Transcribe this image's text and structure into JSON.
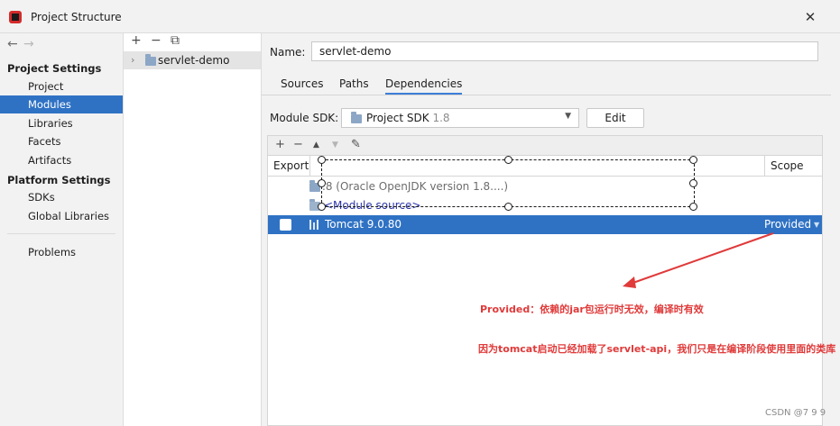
{
  "window": {
    "title": "Project Structure",
    "close_glyph": "✕",
    "app_icon": "intellij-logo-icon"
  },
  "nav": {
    "back_glyph": "←",
    "forward_glyph": "→",
    "project_settings_header": "Project Settings",
    "project_settings_items": [
      "Project",
      "Modules",
      "Libraries",
      "Facets",
      "Artifacts"
    ],
    "platform_settings_header": "Platform Settings",
    "platform_settings_items": [
      "SDKs",
      "Global Libraries"
    ],
    "problems_label": "Problems",
    "selected_item": "Modules"
  },
  "modules_tree": {
    "add_glyph": "+",
    "remove_glyph": "−",
    "copy_glyph": "⧉",
    "chevron": "›",
    "module_name": "servlet-demo"
  },
  "module": {
    "name_label": "Name:",
    "name_value": "servlet-demo",
    "tabs": [
      "Sources",
      "Paths",
      "Dependencies"
    ],
    "active_tab": "Dependencies",
    "sdk_label": "Module SDK:",
    "sdk_name": "Project SDK",
    "sdk_version": "1.8",
    "edit_label": "Edit"
  },
  "deps_toolbar": {
    "add_glyph": "+",
    "remove_glyph": "−",
    "up_glyph": "▲",
    "down_glyph": "▼",
    "edit_glyph": "✎"
  },
  "dependencies": {
    "columns": {
      "export": "Export",
      "scope": "Scope"
    },
    "rows": [
      {
        "name": ".8 (Oracle OpenJDK version 1.8....)",
        "scope": ""
      },
      {
        "name": "<Module source>",
        "scope": ""
      },
      {
        "name": "Tomcat 9.0.80",
        "scope": "Provided",
        "selected": true
      }
    ]
  },
  "annotations": {
    "note_1": "Provided：依赖的jar包运行时无效，编译时有效",
    "note_2": "因为tomcat启动已经加载了servlet-api，我们只是在编译阶段使用里面的类库",
    "color": "#e03a3a"
  },
  "watermark": "CSDN @7 9 9",
  "colors": {
    "selection": "#2f72c4",
    "tab_underline": "#3d7fd6",
    "panel_bg": "#f2f2f2"
  }
}
